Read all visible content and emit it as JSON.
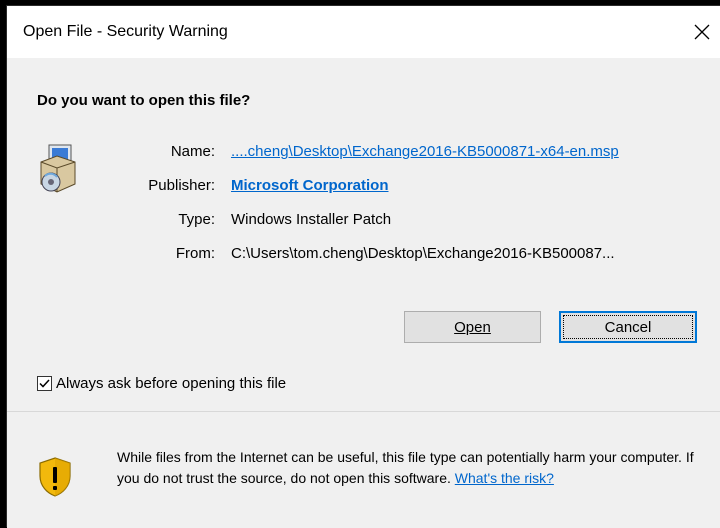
{
  "window": {
    "title": "Open File - Security Warning"
  },
  "question": "Do you want to open this file?",
  "file": {
    "icon": "installer-package-icon",
    "name_label": "Name:",
    "name_value": "....cheng\\Desktop\\Exchange2016-KB5000871-x64-en.msp",
    "publisher_label": "Publisher:",
    "publisher_value": "Microsoft Corporation",
    "type_label": "Type:",
    "type_value": "Windows Installer Patch",
    "from_label": "From:",
    "from_value": "C:\\Users\\tom.cheng\\Desktop\\Exchange2016-KB500087..."
  },
  "buttons": {
    "open_label": "Open",
    "cancel_label": "Cancel"
  },
  "checkbox": {
    "label": "Always ask before opening this file",
    "checked": true
  },
  "warning": {
    "icon": "shield-warning-icon",
    "text": "While files from the Internet can be useful, this file type can potentially harm your computer. If you do not trust the source, do not open this software.",
    "link": "What's the risk?"
  },
  "colors": {
    "link": "#0066cc",
    "focus_border": "#0078d7",
    "shield_yellow": "#f2b90c"
  }
}
